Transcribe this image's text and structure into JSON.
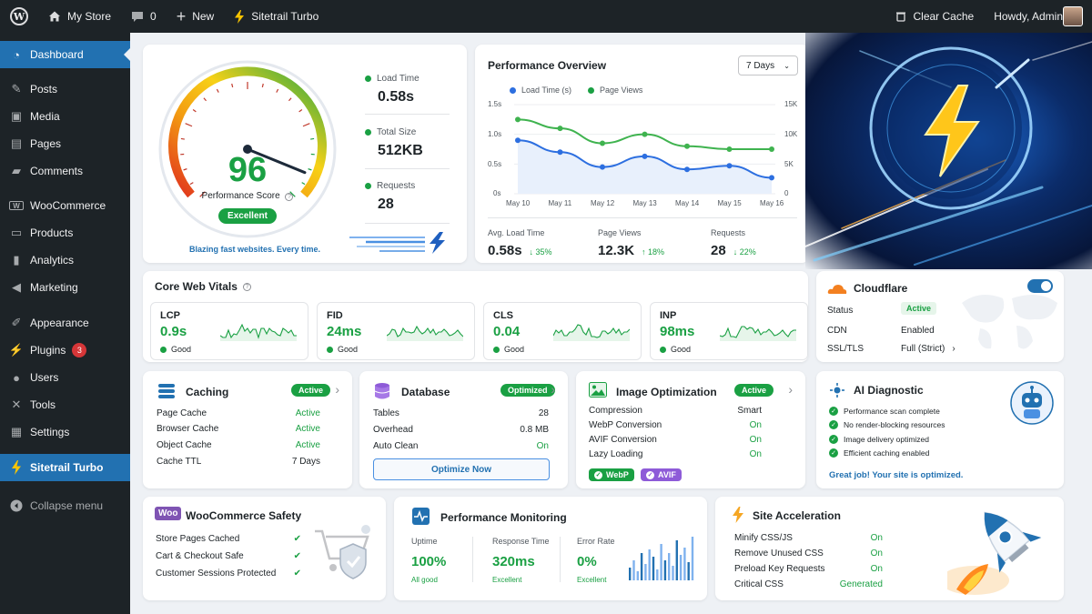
{
  "adminbar": {
    "site_name": "My Store",
    "comments_count": "0",
    "new_label": "New",
    "plugin_label": "Sitetrail Turbo",
    "clear_cache": "Clear Cache",
    "howdy": "Howdy, Admin"
  },
  "sidebar": {
    "items": [
      {
        "label": "Dashboard",
        "icon": "dashboard-icon"
      },
      {
        "label": "Posts",
        "icon": "pin-icon"
      },
      {
        "label": "Media",
        "icon": "media-icon"
      },
      {
        "label": "Pages",
        "icon": "pages-icon"
      },
      {
        "label": "Comments",
        "icon": "comment-icon"
      },
      {
        "label": "WooCommerce",
        "icon": "woo-icon"
      },
      {
        "label": "Products",
        "icon": "archive-icon"
      },
      {
        "label": "Analytics",
        "icon": "chart-icon"
      },
      {
        "label": "Marketing",
        "icon": "megaphone-icon"
      },
      {
        "label": "Appearance",
        "icon": "brush-icon"
      },
      {
        "label": "Plugins",
        "icon": "plugin-icon",
        "badge": "3"
      },
      {
        "label": "Users",
        "icon": "user-icon"
      },
      {
        "label": "Tools",
        "icon": "wrench-icon"
      },
      {
        "label": "Settings",
        "icon": "settings-icon"
      },
      {
        "label": "Sitetrail Turbo",
        "icon": "bolt-icon"
      }
    ],
    "collapse": "Collapse menu"
  },
  "score": {
    "value": "96",
    "score_fraction": 0.96,
    "label": "Performance Score",
    "rating": "Excellent",
    "tagline": "Blazing fast websites. Every time.",
    "stats": [
      {
        "label": "Load Time",
        "value": "0.58s"
      },
      {
        "label": "Total Size",
        "value": "512KB"
      },
      {
        "label": "Requests",
        "value": "28"
      }
    ]
  },
  "overview": {
    "title": "Performance Overview",
    "range": "7 Days",
    "legend_load": "Load Time (s)",
    "legend_views": "Page Views",
    "colors": {
      "load": "#2d6fe0",
      "views": "#3fb34f"
    },
    "summary": [
      {
        "label": "Avg. Load Time",
        "value": "0.58s",
        "delta": "↓ 35%"
      },
      {
        "label": "Page Views",
        "value": "12.3K",
        "delta": "↑ 18%"
      },
      {
        "label": "Requests",
        "value": "28",
        "delta": "↓ 22%"
      }
    ]
  },
  "chart_data": {
    "type": "line",
    "categories": [
      "May 10",
      "May 11",
      "May 12",
      "May 13",
      "May 14",
      "May 15",
      "May 16"
    ],
    "series": [
      {
        "name": "Load Time (s)",
        "axis": "left",
        "values": [
          0.9,
          0.7,
          0.45,
          0.63,
          0.41,
          0.47,
          0.27
        ]
      },
      {
        "name": "Page Views",
        "axis": "right",
        "values": [
          12500,
          11000,
          8500,
          10000,
          8000,
          7500,
          7500
        ]
      }
    ],
    "y_left": {
      "ticks": [
        "1.5s",
        "1.0s",
        "0.5s",
        "0s"
      ],
      "ylim": [
        0,
        1.5
      ]
    },
    "y_right": {
      "ticks": [
        "15K",
        "10K",
        "5K",
        "0"
      ],
      "ylim": [
        0,
        15000
      ]
    }
  },
  "vitals": {
    "title": "Core Web Vitals",
    "items": [
      {
        "name": "LCP",
        "value": "0.9s",
        "status": "Good"
      },
      {
        "name": "FID",
        "value": "24ms",
        "status": "Good"
      },
      {
        "name": "CLS",
        "value": "0.04",
        "status": "Good"
      },
      {
        "name": "INP",
        "value": "98ms",
        "status": "Good"
      }
    ]
  },
  "cloudflare": {
    "title": "Cloudflare",
    "enabled": true,
    "rows": [
      {
        "k": "Status",
        "v": "Active"
      },
      {
        "k": "CDN",
        "v": "Enabled"
      },
      {
        "k": "SSL/TLS",
        "v": "Full (Strict)"
      }
    ]
  },
  "caching": {
    "title": "Caching",
    "badge": "Active",
    "rows": [
      {
        "k": "Page Cache",
        "v": "Active"
      },
      {
        "k": "Browser Cache",
        "v": "Active"
      },
      {
        "k": "Object Cache",
        "v": "Active"
      },
      {
        "k": "Cache TTL",
        "v": "7 Days"
      }
    ]
  },
  "database": {
    "title": "Database",
    "badge": "Optimized",
    "rows": [
      {
        "k": "Tables",
        "v": "28"
      },
      {
        "k": "Overhead",
        "v": "0.8 MB"
      },
      {
        "k": "Auto Clean",
        "v": "On"
      }
    ],
    "button": "Optimize Now"
  },
  "images": {
    "title": "Image Optimization",
    "badge": "Active",
    "rows": [
      {
        "k": "Compression",
        "v": "Smart"
      },
      {
        "k": "WebP Conversion",
        "v": "On"
      },
      {
        "k": "AVIF Conversion",
        "v": "On"
      },
      {
        "k": "Lazy Loading",
        "v": "On"
      }
    ],
    "tag_webp": "WebP",
    "tag_avif": "AVIF"
  },
  "ai": {
    "title": "AI Diagnostic",
    "items": [
      "Performance scan complete",
      "No render-blocking resources",
      "Image delivery optimized",
      "Efficient caching enabled"
    ],
    "footer": "Great job! Your site is optimized."
  },
  "woo": {
    "title": "WooCommerce Safety",
    "logo": "Woo",
    "items": [
      "Store Pages Cached",
      "Cart & Checkout Safe",
      "Customer Sessions Protected"
    ]
  },
  "monitoring": {
    "title": "Performance Monitoring",
    "cols": [
      {
        "label": "Uptime",
        "value": "100%",
        "sub": "All good"
      },
      {
        "label": "Response Time",
        "value": "320ms",
        "sub": "Excellent"
      },
      {
        "label": "Error Rate",
        "value": "0%",
        "sub": "Excellent"
      }
    ]
  },
  "acceleration": {
    "title": "Site Acceleration",
    "rows": [
      {
        "k": "Minify CSS/JS",
        "v": "On"
      },
      {
        "k": "Remove Unused CSS",
        "v": "On"
      },
      {
        "k": "Preload Key Requests",
        "v": "On"
      },
      {
        "k": "Critical CSS",
        "v": "Generated"
      }
    ]
  }
}
